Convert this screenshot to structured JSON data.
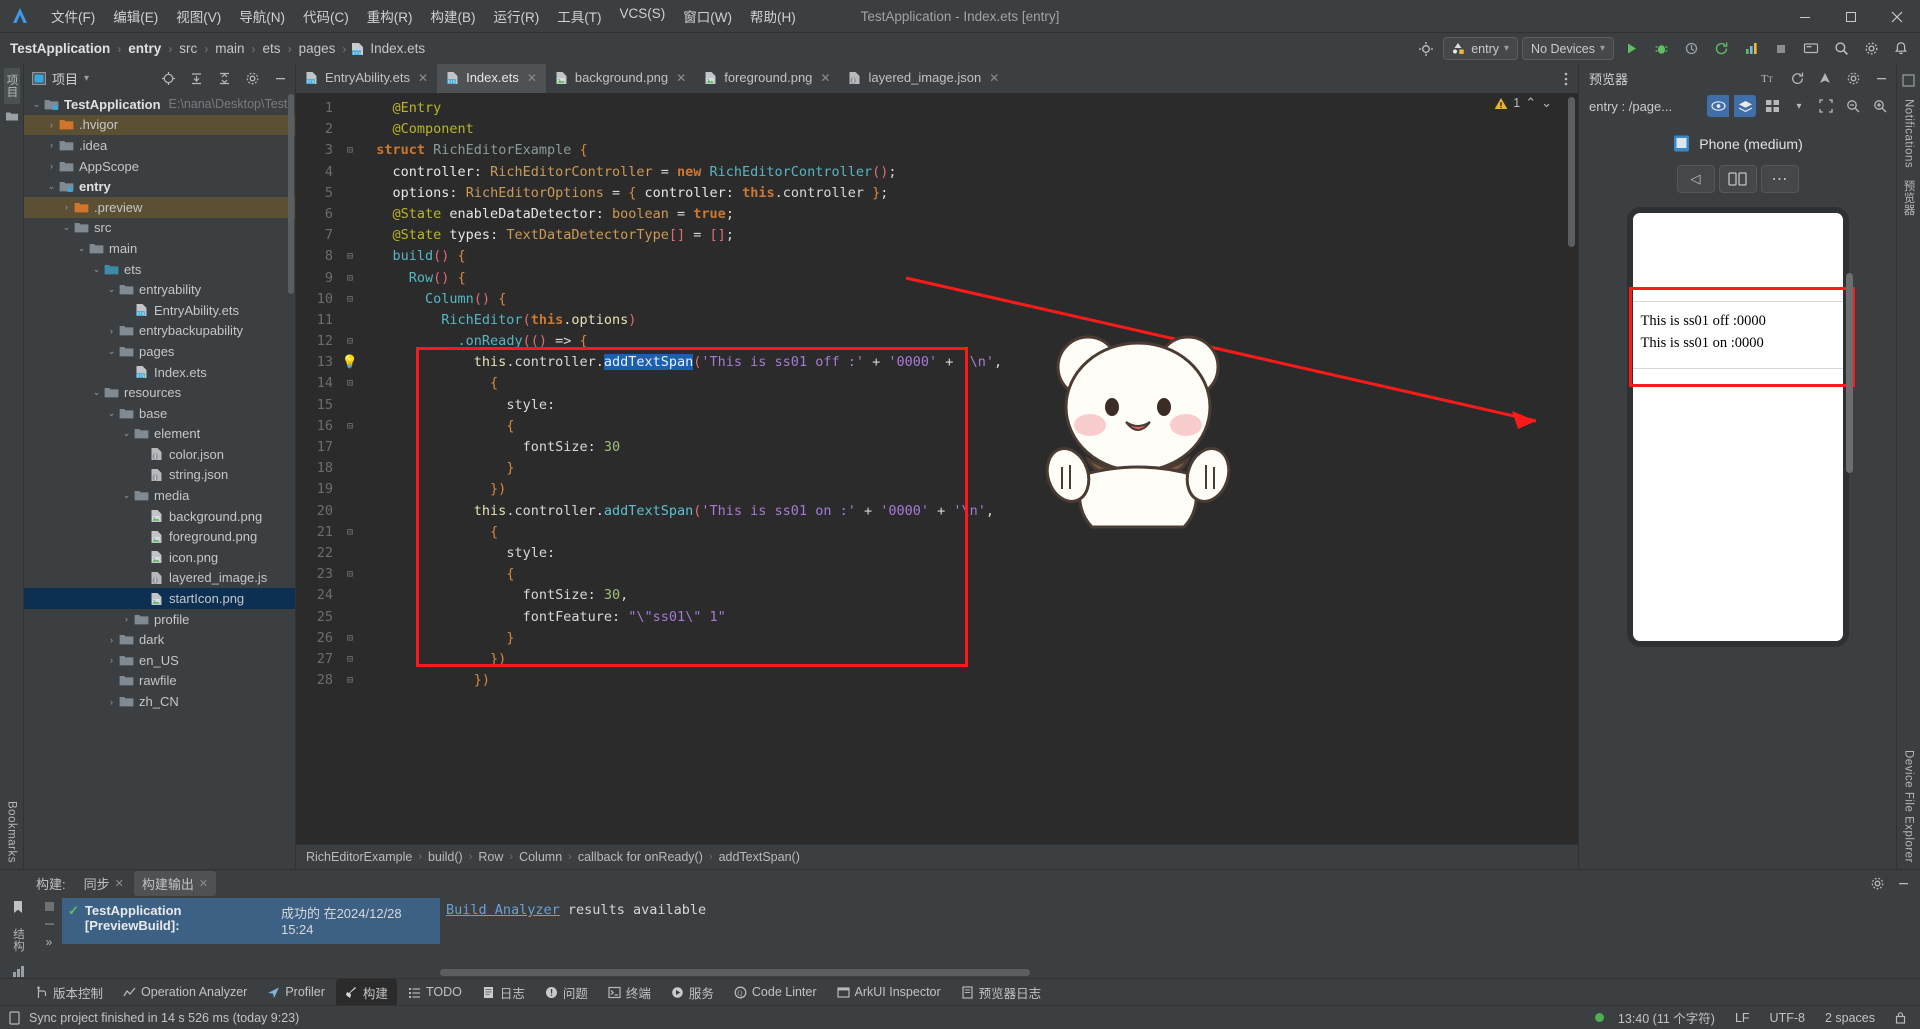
{
  "window": {
    "title": "TestApplication - Index.ets [entry]",
    "minimize": "–",
    "maximize": "□",
    "close": "✕"
  },
  "menubar": {
    "items": [
      {
        "label": "文件(F)"
      },
      {
        "label": "编辑(E)"
      },
      {
        "label": "视图(V)"
      },
      {
        "label": "导航(N)"
      },
      {
        "label": "代码(C)"
      },
      {
        "label": "重构(R)"
      },
      {
        "label": "构建(B)"
      },
      {
        "label": "运行(R)"
      },
      {
        "label": "工具(T)"
      },
      {
        "label": "VCS(S)"
      },
      {
        "label": "窗口(W)"
      },
      {
        "label": "帮助(H)"
      }
    ]
  },
  "breadcrumb": {
    "parts": [
      "TestApplication",
      "entry",
      "src",
      "main",
      "ets",
      "pages",
      "Index.ets"
    ],
    "separator": "›"
  },
  "navtoolbar": {
    "run_config": "entry",
    "device": "No Devices",
    "dropdown_caret": "▾"
  },
  "project_panel": {
    "title": "项目",
    "caret": "▾",
    "tree": [
      {
        "label": "TestApplication",
        "path": "E:\\nana\\Desktop\\Test",
        "depth": 0,
        "arrow": "⌄",
        "icon": "module-folder",
        "bold": true,
        "state": "normal"
      },
      {
        "label": ".hvigor",
        "depth": 1,
        "arrow": "›",
        "icon": "orange-folder",
        "state": "highlight"
      },
      {
        "label": ".idea",
        "depth": 1,
        "arrow": "›",
        "icon": "folder",
        "state": "normal"
      },
      {
        "label": "AppScope",
        "depth": 1,
        "arrow": "›",
        "icon": "folder",
        "state": "normal"
      },
      {
        "label": "entry",
        "depth": 1,
        "arrow": "⌄",
        "icon": "module-folder",
        "bold": true,
        "state": "normal"
      },
      {
        "label": ".preview",
        "depth": 2,
        "arrow": "›",
        "icon": "orange-folder",
        "state": "highlight"
      },
      {
        "label": "src",
        "depth": 2,
        "arrow": "⌄",
        "icon": "folder",
        "state": "normal"
      },
      {
        "label": "main",
        "depth": 3,
        "arrow": "⌄",
        "icon": "folder",
        "state": "normal"
      },
      {
        "label": "ets",
        "depth": 4,
        "arrow": "⌄",
        "icon": "source-folder",
        "state": "normal"
      },
      {
        "label": "entryability",
        "depth": 5,
        "arrow": "⌄",
        "icon": "folder",
        "state": "normal"
      },
      {
        "label": "EntryAbility.ets",
        "depth": 6,
        "arrow": "",
        "icon": "ets-file",
        "state": "normal"
      },
      {
        "label": "entrybackupability",
        "depth": 5,
        "arrow": "›",
        "icon": "folder",
        "state": "normal"
      },
      {
        "label": "pages",
        "depth": 5,
        "arrow": "⌄",
        "icon": "folder",
        "state": "normal"
      },
      {
        "label": "Index.ets",
        "depth": 6,
        "arrow": "",
        "icon": "ets-file",
        "state": "normal"
      },
      {
        "label": "resources",
        "depth": 4,
        "arrow": "⌄",
        "icon": "folder",
        "state": "normal"
      },
      {
        "label": "base",
        "depth": 5,
        "arrow": "⌄",
        "icon": "folder",
        "state": "normal"
      },
      {
        "label": "element",
        "depth": 6,
        "arrow": "⌄",
        "icon": "folder",
        "state": "normal"
      },
      {
        "label": "color.json",
        "depth": 7,
        "arrow": "",
        "icon": "json-file",
        "state": "normal"
      },
      {
        "label": "string.json",
        "depth": 7,
        "arrow": "",
        "icon": "json-file",
        "state": "normal"
      },
      {
        "label": "media",
        "depth": 6,
        "arrow": "⌄",
        "icon": "folder",
        "state": "normal"
      },
      {
        "label": "background.png",
        "depth": 7,
        "arrow": "",
        "icon": "image-file",
        "state": "normal"
      },
      {
        "label": "foreground.png",
        "depth": 7,
        "arrow": "",
        "icon": "image-file",
        "state": "normal"
      },
      {
        "label": "icon.png",
        "depth": 7,
        "arrow": "",
        "icon": "image-file",
        "state": "normal"
      },
      {
        "label": "layered_image.js",
        "depth": 7,
        "arrow": "",
        "icon": "json-file",
        "state": "normal"
      },
      {
        "label": "startIcon.png",
        "depth": 7,
        "arrow": "",
        "icon": "image-file",
        "state": "selected"
      },
      {
        "label": "profile",
        "depth": 6,
        "arrow": "›",
        "icon": "folder",
        "state": "normal"
      },
      {
        "label": "dark",
        "depth": 5,
        "arrow": "›",
        "icon": "folder",
        "state": "normal"
      },
      {
        "label": "en_US",
        "depth": 5,
        "arrow": "›",
        "icon": "folder",
        "state": "normal"
      },
      {
        "label": "rawfile",
        "depth": 5,
        "arrow": "",
        "icon": "folder",
        "state": "normal"
      },
      {
        "label": "zh_CN",
        "depth": 5,
        "arrow": "›",
        "icon": "folder",
        "state": "normal"
      }
    ]
  },
  "editor": {
    "tabs": [
      {
        "label": "EntryAbility.ets",
        "icon": "ets-file",
        "active": false,
        "close": "✕"
      },
      {
        "label": "Index.ets",
        "icon": "ets-file",
        "active": true,
        "close": "✕"
      },
      {
        "label": "background.png",
        "icon": "image-file",
        "active": false,
        "close": "✕"
      },
      {
        "label": "foreground.png",
        "icon": "image-file",
        "active": false,
        "close": "✕"
      },
      {
        "label": "layered_image.json",
        "icon": "json-file",
        "active": false,
        "close": "✕"
      }
    ],
    "warning_count": "1",
    "warning_up": "⌃",
    "warning_down": "⌄",
    "lines": [
      {
        "n": "1",
        "fold": "",
        "indent": 2,
        "tokens": [
          {
            "t": "@Entry",
            "c": "k-ann"
          }
        ]
      },
      {
        "n": "2",
        "fold": "",
        "indent": 2,
        "tokens": [
          {
            "t": "@Component",
            "c": "k-ann"
          }
        ]
      },
      {
        "n": "3",
        "fold": "⊟",
        "indent": 1,
        "tokens": [
          {
            "t": "struct ",
            "c": "k-kw"
          },
          {
            "t": "RichEditorExample",
            "c": "k-cls"
          },
          {
            "t": " {",
            "c": "k-brk"
          }
        ]
      },
      {
        "n": "4",
        "fold": "",
        "indent": 2,
        "tokens": [
          {
            "t": "controller",
            "c": "k-prop"
          },
          {
            "t": ": ",
            "c": "k-plain"
          },
          {
            "t": "RichEditorController",
            "c": "k-type"
          },
          {
            "t": " = ",
            "c": "k-plain"
          },
          {
            "t": "new ",
            "c": "k-kw"
          },
          {
            "t": "RichEditorController",
            "c": "k-fn"
          },
          {
            "t": "()",
            "c": "k-paren"
          },
          {
            "t": ";",
            "c": "k-plain"
          }
        ]
      },
      {
        "n": "5",
        "fold": "",
        "indent": 2,
        "tokens": [
          {
            "t": "options",
            "c": "k-prop"
          },
          {
            "t": ": ",
            "c": "k-plain"
          },
          {
            "t": "RichEditorOptions",
            "c": "k-type"
          },
          {
            "t": " = ",
            "c": "k-plain"
          },
          {
            "t": "{ ",
            "c": "k-brk"
          },
          {
            "t": "controller",
            "c": "k-prop"
          },
          {
            "t": ": ",
            "c": "k-plain"
          },
          {
            "t": "this",
            "c": "k-kw"
          },
          {
            "t": ".controller ",
            "c": "k-plain"
          },
          {
            "t": "}",
            "c": "k-brk"
          },
          {
            "t": ";",
            "c": "k-plain"
          }
        ]
      },
      {
        "n": "6",
        "fold": "",
        "indent": 2,
        "tokens": [
          {
            "t": "@State ",
            "c": "k-ann"
          },
          {
            "t": "enableDataDetector",
            "c": "k-prop"
          },
          {
            "t": ": ",
            "c": "k-plain"
          },
          {
            "t": "boolean",
            "c": "k-type"
          },
          {
            "t": " = ",
            "c": "k-plain"
          },
          {
            "t": "true",
            "c": "k-kw"
          },
          {
            "t": ";",
            "c": "k-plain"
          }
        ]
      },
      {
        "n": "7",
        "fold": "",
        "indent": 2,
        "tokens": [
          {
            "t": "@State ",
            "c": "k-ann"
          },
          {
            "t": "types",
            "c": "k-prop"
          },
          {
            "t": ": ",
            "c": "k-plain"
          },
          {
            "t": "TextDataDetectorType",
            "c": "k-type"
          },
          {
            "t": "[]",
            "c": "k-paren"
          },
          {
            "t": " = ",
            "c": "k-plain"
          },
          {
            "t": "[]",
            "c": "k-paren"
          },
          {
            "t": ";",
            "c": "k-plain"
          }
        ]
      },
      {
        "n": "8",
        "fold": "⊟",
        "indent": 2,
        "tokens": [
          {
            "t": "build",
            "c": "k-fn"
          },
          {
            "t": "()",
            "c": "k-paren"
          },
          {
            "t": " {",
            "c": "k-brk"
          }
        ]
      },
      {
        "n": "9",
        "fold": "⊟",
        "indent": 3,
        "tokens": [
          {
            "t": "Row",
            "c": "k-fn"
          },
          {
            "t": "()",
            "c": "k-paren"
          },
          {
            "t": " {",
            "c": "k-brk"
          }
        ]
      },
      {
        "n": "10",
        "fold": "⊟",
        "indent": 4,
        "tokens": [
          {
            "t": "Column",
            "c": "k-fn"
          },
          {
            "t": "()",
            "c": "k-paren"
          },
          {
            "t": " {",
            "c": "k-brk"
          }
        ]
      },
      {
        "n": "11",
        "fold": "",
        "indent": 5,
        "tokens": [
          {
            "t": "RichEditor",
            "c": "k-fn"
          },
          {
            "t": "(",
            "c": "k-paren"
          },
          {
            "t": "this",
            "c": "k-kw"
          },
          {
            "t": ".options",
            "c": "k-this"
          },
          {
            "t": ")",
            "c": "k-paren"
          }
        ]
      },
      {
        "n": "12",
        "fold": "⊟",
        "indent": 6,
        "tokens": [
          {
            "t": ".onReady",
            "c": "k-fn"
          },
          {
            "t": "(()",
            "c": "k-paren"
          },
          {
            "t": " => ",
            "c": "k-plain"
          },
          {
            "t": "{",
            "c": "k-brk"
          }
        ]
      },
      {
        "n": "13",
        "fold": "",
        "indent": 7,
        "bulb": true,
        "tokens": [
          {
            "t": "this",
            "c": "k-this"
          },
          {
            "t": ".controller.",
            "c": "k-plain"
          },
          {
            "t": "addTextSpan",
            "c": "sel-token"
          },
          {
            "t": "(",
            "c": "k-paren"
          },
          {
            "t": "'This is ss01 off :'",
            "c": "k-str"
          },
          {
            "t": " + ",
            "c": "k-plain"
          },
          {
            "t": "'0000'",
            "c": "k-str"
          },
          {
            "t": " + ",
            "c": "k-plain"
          },
          {
            "t": "'\\n'",
            "c": "k-str"
          },
          {
            "t": ",",
            "c": "k-plain"
          }
        ]
      },
      {
        "n": "14",
        "fold": "⊟",
        "indent": 8,
        "tokens": [
          {
            "t": "{",
            "c": "k-brk"
          }
        ]
      },
      {
        "n": "15",
        "fold": "",
        "indent": 9,
        "tokens": [
          {
            "t": "style",
            "c": "k-plain"
          },
          {
            "t": ":",
            "c": "k-plain"
          }
        ]
      },
      {
        "n": "16",
        "fold": "⊟",
        "indent": 9,
        "tokens": [
          {
            "t": "{",
            "c": "k-brk"
          }
        ]
      },
      {
        "n": "17",
        "fold": "",
        "indent": 10,
        "tokens": [
          {
            "t": "fontSize",
            "c": "k-plain"
          },
          {
            "t": ": ",
            "c": "k-plain"
          },
          {
            "t": "30",
            "c": "k-num"
          }
        ]
      },
      {
        "n": "18",
        "fold": "",
        "indent": 9,
        "tokens": [
          {
            "t": "}",
            "c": "k-brk"
          }
        ]
      },
      {
        "n": "19",
        "fold": "",
        "indent": 8,
        "tokens": [
          {
            "t": "})",
            "c": "k-brk"
          }
        ]
      },
      {
        "n": "20",
        "fold": "",
        "indent": 7,
        "tokens": [
          {
            "t": "this",
            "c": "k-this"
          },
          {
            "t": ".controller.",
            "c": "k-plain"
          },
          {
            "t": "addTextSpan",
            "c": "k-fn2"
          },
          {
            "t": "(",
            "c": "k-paren"
          },
          {
            "t": "'This is ss01 on :'",
            "c": "k-str"
          },
          {
            "t": " + ",
            "c": "k-plain"
          },
          {
            "t": "'0000'",
            "c": "k-str"
          },
          {
            "t": " + ",
            "c": "k-plain"
          },
          {
            "t": "'\\n'",
            "c": "k-str"
          },
          {
            "t": ",",
            "c": "k-plain"
          }
        ]
      },
      {
        "n": "21",
        "fold": "⊟",
        "indent": 8,
        "tokens": [
          {
            "t": "{",
            "c": "k-brk"
          }
        ]
      },
      {
        "n": "22",
        "fold": "",
        "indent": 9,
        "tokens": [
          {
            "t": "style",
            "c": "k-plain"
          },
          {
            "t": ":",
            "c": "k-plain"
          }
        ]
      },
      {
        "n": "23",
        "fold": "⊟",
        "indent": 9,
        "tokens": [
          {
            "t": "{",
            "c": "k-brk"
          }
        ]
      },
      {
        "n": "24",
        "fold": "",
        "indent": 10,
        "tokens": [
          {
            "t": "fontSize",
            "c": "k-plain"
          },
          {
            "t": ": ",
            "c": "k-plain"
          },
          {
            "t": "30",
            "c": "k-num"
          },
          {
            "t": ",",
            "c": "k-plain"
          }
        ]
      },
      {
        "n": "25",
        "fold": "",
        "indent": 10,
        "tokens": [
          {
            "t": "fontFeature",
            "c": "k-plain"
          },
          {
            "t": ": ",
            "c": "k-plain"
          },
          {
            "t": "\"\\\"ss01\\\" 1\"",
            "c": "k-str"
          }
        ]
      },
      {
        "n": "26",
        "fold": "⊟",
        "indent": 9,
        "tokens": [
          {
            "t": "}",
            "c": "k-brk"
          }
        ]
      },
      {
        "n": "27",
        "fold": "⊟",
        "indent": 8,
        "tokens": [
          {
            "t": "})",
            "c": "k-brk"
          }
        ]
      },
      {
        "n": "28",
        "fold": "⊟",
        "indent": 7,
        "tokens": [
          {
            "t": "})",
            "c": "k-brk"
          }
        ]
      }
    ],
    "status_breadcrumb": [
      "RichEditorExample",
      "build()",
      "Row",
      "Column",
      "callback for onReady()",
      "addTextSpan()"
    ],
    "status_separator": "›"
  },
  "previewer": {
    "title": "预览器",
    "file": "entry : /page...",
    "device_name": "Phone (medium)",
    "controls": {
      "rotate": "◁",
      "multi": "▯▯",
      "more": "⋯"
    },
    "render_lines": [
      "This is ss01 off :0000",
      "This is ss01 on :0000"
    ]
  },
  "right_rail": {
    "items": [
      "Notifications",
      "预览器",
      "Device File Explorer"
    ]
  },
  "left_rail": {
    "items": [
      "项目",
      "Bookmarks",
      "结构"
    ]
  },
  "bottom_panel": {
    "group_label": "构建:",
    "tabs": [
      {
        "label": "同步",
        "active": false,
        "close": "✕"
      },
      {
        "label": "构建输出",
        "active": true,
        "close": "✕"
      }
    ],
    "build_entry": {
      "check": "✓",
      "name": "TestApplication [PreviewBuild]:",
      "status": "成功的 在2024/12/28 15:24"
    },
    "output_link": "Build Analyzer",
    "output_rest": " results available",
    "expand": "»"
  },
  "toolwindow_bar": {
    "items": [
      {
        "label": "版本控制",
        "icon": "branch-icon",
        "active": false
      },
      {
        "label": "Operation Analyzer",
        "icon": "chart-icon",
        "active": false
      },
      {
        "label": "Profiler",
        "icon": "profiler-icon",
        "active": false
      },
      {
        "label": "构建",
        "icon": "hammer-icon",
        "active": true
      },
      {
        "label": "TODO",
        "icon": "list-icon",
        "active": false
      },
      {
        "label": "日志",
        "icon": "log-icon",
        "active": false
      },
      {
        "label": "问题",
        "icon": "warning-icon",
        "active": false
      },
      {
        "label": "终端",
        "icon": "terminal-icon",
        "active": false
      },
      {
        "label": "服务",
        "icon": "services-icon",
        "active": false
      },
      {
        "label": "Code Linter",
        "icon": "linter-icon",
        "active": false
      },
      {
        "label": "ArkUI Inspector",
        "icon": "inspector-icon",
        "active": false
      },
      {
        "label": "预览器日志",
        "icon": "preview-log-icon",
        "active": false
      }
    ]
  },
  "statusbar": {
    "message": "Sync project finished in 14 s 526 ms (today 9:23)",
    "caret": "13:40 (11 个字符)",
    "line_sep": "LF",
    "encoding": "UTF-8",
    "indent": "2 spaces"
  },
  "colors": {
    "accent_red": "#ff1a1a",
    "panel_bg": "#3c3f41",
    "editor_bg": "#2b2b2b",
    "selection_blue": "#3d6185",
    "tree_selected": "#0d2f52"
  }
}
